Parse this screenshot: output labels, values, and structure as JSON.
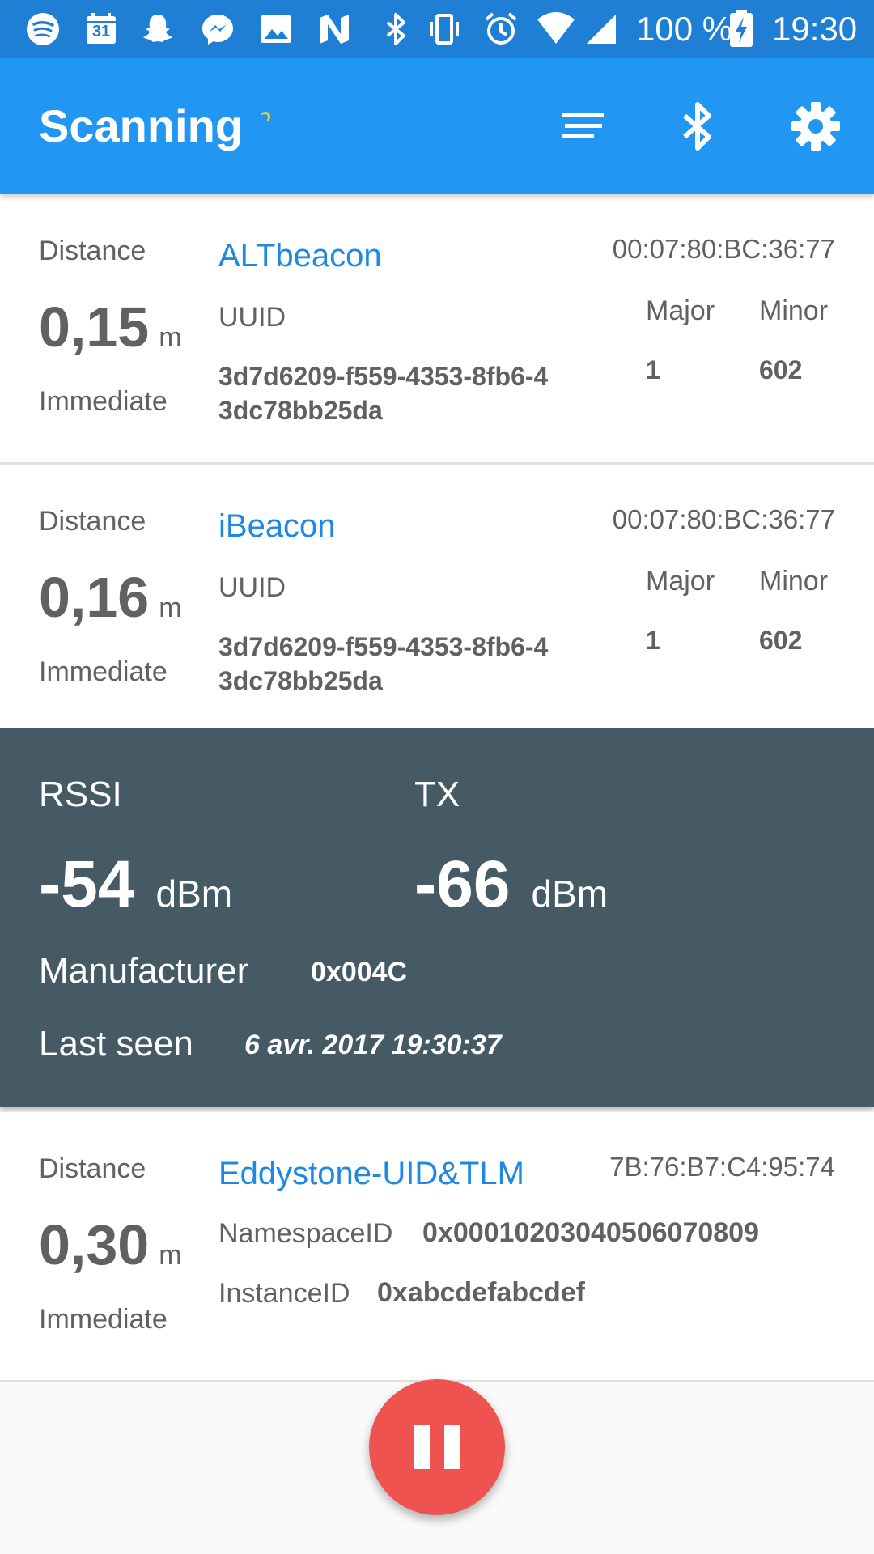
{
  "status_bar": {
    "battery": "100 %",
    "time": "19:30",
    "calendar_day": "31",
    "icons": [
      "spotify-icon",
      "calendar-icon",
      "snapchat-icon",
      "messenger-icon",
      "gallery-icon",
      "nfc-icon",
      "bluetooth-icon",
      "vibrate-icon",
      "alarm-icon",
      "wifi-icon",
      "signal-icon",
      "battery-charging-icon"
    ]
  },
  "app_bar": {
    "title": "Scanning",
    "actions": [
      "sort-icon",
      "bluetooth-icon",
      "settings-icon"
    ]
  },
  "beacons": [
    {
      "distance_label": "Distance",
      "distance_value": "0,15",
      "distance_unit": "m",
      "proximity": "Immediate",
      "type": "ALTbeacon",
      "mac": "00:07:80:BC:36:77",
      "uuid_label": "UUID",
      "uuid_line1": "3d7d6209-f559-4353-8fb6-4",
      "uuid_line2": "3dc78bb25da",
      "major_label": "Major",
      "minor_label": "Minor",
      "major": "1",
      "minor": "602"
    },
    {
      "distance_label": "Distance",
      "distance_value": "0,16",
      "distance_unit": "m",
      "proximity": "Immediate",
      "type": "iBeacon",
      "mac": "00:07:80:BC:36:77",
      "uuid_label": "UUID",
      "uuid_line1": "3d7d6209-f559-4353-8fb6-4",
      "uuid_line2": "3dc78bb25da",
      "major_label": "Major",
      "minor_label": "Minor",
      "major": "1",
      "minor": "602"
    },
    {
      "distance_label": "Distance",
      "distance_value": "0,30",
      "distance_unit": "m",
      "proximity": "Immediate",
      "type": "Eddystone-UID&TLM",
      "mac": "7B:76:B7:C4:95:74",
      "namespace_label": "NamespaceID",
      "namespace": "0x00010203040506070809",
      "instance_label": "InstanceID",
      "instance": "0xabcdefabcdef"
    }
  ],
  "details": {
    "rssi_label": "RSSI",
    "rssi_value": "-54",
    "rssi_unit": "dBm",
    "tx_label": "TX",
    "tx_value": "-66",
    "tx_unit": "dBm",
    "manufacturer_label": "Manufacturer",
    "manufacturer": "0x004C",
    "last_seen_label": "Last seen",
    "last_seen": "6 avr. 2017 19:30:37"
  },
  "fab": {
    "icon": "pause-icon"
  },
  "colors": {
    "status_bar": "#1e7fd4",
    "app_bar": "#2196f3",
    "detail_panel": "#455a64",
    "beacon_type": "#1e88e5",
    "fab": "#ef5350"
  }
}
